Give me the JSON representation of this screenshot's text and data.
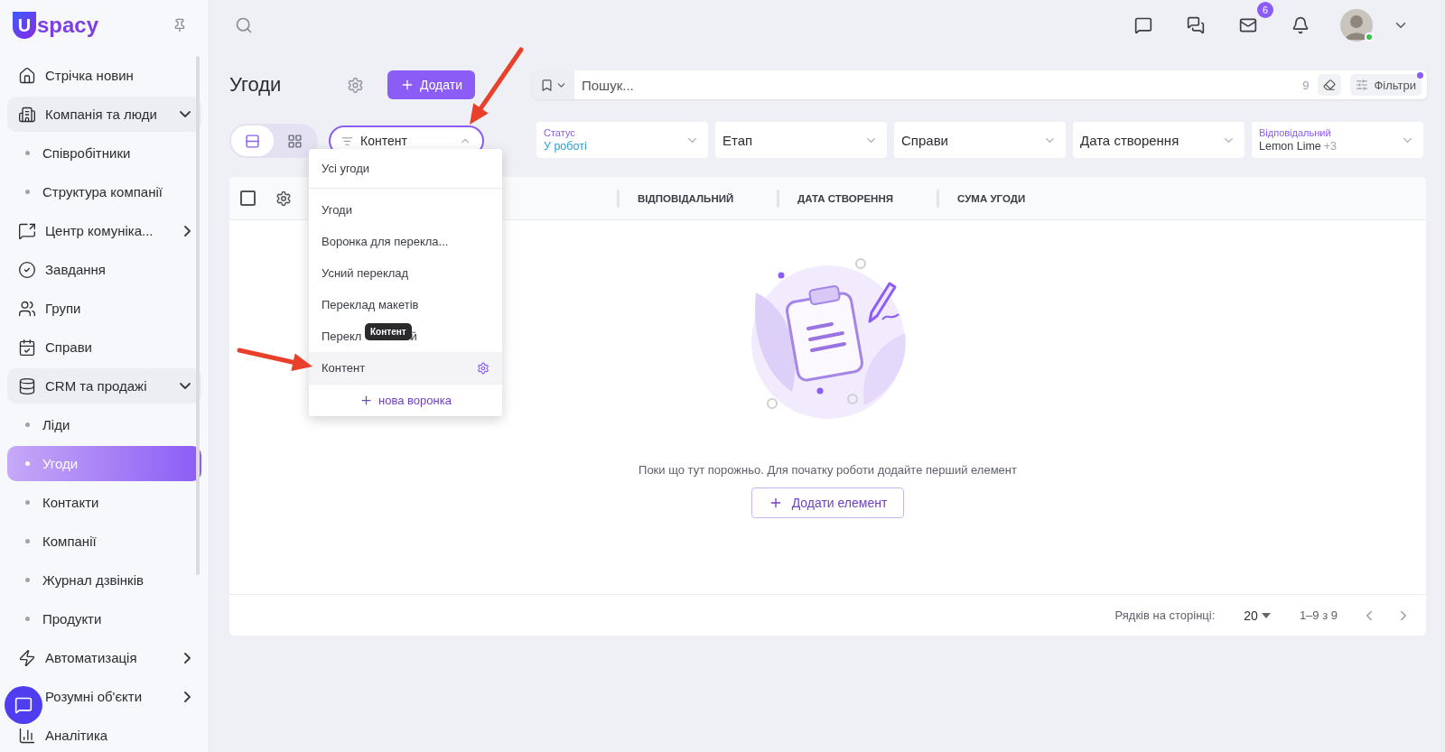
{
  "logo": {
    "mark": "U",
    "text": "spacy"
  },
  "sidebar": {
    "items": [
      {
        "kind": "item",
        "label": "Стрічка новин"
      },
      {
        "kind": "group",
        "label": "Компанія та люди",
        "expanded": true,
        "children": [
          {
            "label": "Співробітники",
            "selected": false
          },
          {
            "label": "Структура компанії",
            "selected": false
          }
        ]
      },
      {
        "kind": "group",
        "label": "Центр комуніка...",
        "expanded": false
      },
      {
        "kind": "item",
        "label": "Завдання"
      },
      {
        "kind": "item",
        "label": "Групи"
      },
      {
        "kind": "item",
        "label": "Справи"
      },
      {
        "kind": "group",
        "label": "CRM та продажі",
        "expanded": true,
        "children": [
          {
            "label": "Ліди",
            "selected": false
          },
          {
            "label": "Угоди",
            "selected": true
          },
          {
            "label": "Контакти",
            "selected": false
          },
          {
            "label": "Компанії",
            "selected": false
          },
          {
            "label": "Журнал дзвінків",
            "selected": false
          },
          {
            "label": "Продукти",
            "selected": false
          }
        ]
      },
      {
        "kind": "group",
        "label": "Автоматизація",
        "expanded": false
      },
      {
        "kind": "group",
        "label": "Розумні об'єкти",
        "expanded": false
      },
      {
        "kind": "item",
        "label": "Аналітика"
      }
    ]
  },
  "topbar": {
    "mail_badge": "6",
    "user_online": true
  },
  "page": {
    "title": "Угоди",
    "add_button": "Додати"
  },
  "search": {
    "placeholder": "Пошук...",
    "count": "9",
    "filters_button": "Фільтри",
    "filters_active": true
  },
  "view_toggle": [
    {
      "kind": "list",
      "selected": true
    },
    {
      "kind": "grid",
      "selected": false
    }
  ],
  "pipeline_select": {
    "value": "Контент",
    "open": true
  },
  "pipeline_menu": {
    "items": [
      {
        "label": "Усі угоди",
        "hovered": false
      },
      {
        "label": "Угоди",
        "hovered": false
      },
      {
        "label": "Воронка для перекла...",
        "hovered": false
      },
      {
        "label": "Усний переклад",
        "hovered": false
      },
      {
        "label": "Переклад макетів",
        "hovered": false
      },
      {
        "label": "Перекл",
        "label_end": "й",
        "hovered": false
      },
      {
        "label": "Контент",
        "hovered": true
      }
    ],
    "new_button": "нова воронка",
    "tooltip": "Контент"
  },
  "filters": [
    {
      "label": "Статус",
      "value": "У роботі"
    },
    {
      "label": "Етап"
    },
    {
      "label": "Справи"
    },
    {
      "label": "Дата створення"
    },
    {
      "label": "Відповідальний",
      "value": "Lemon Lime",
      "extra": "+3"
    }
  ],
  "table": {
    "select_all": {
      "checked": false
    },
    "columns": [
      "ВІДПОВІДАЛЬНИЙ",
      "ДАТА СТВОРЕННЯ",
      "СУМА УГОДИ"
    ],
    "empty_text": "Поки що тут порожньо. Для початку роботи додайте перший елемент",
    "empty_button": "Додати елемент"
  },
  "pagination": {
    "rows_label": "Рядків на сторінці:",
    "rows_value": "20",
    "range": "1–9 з 9"
  },
  "annotations": [
    {
      "kind": "arrow"
    },
    {
      "kind": "arrow"
    }
  ]
}
